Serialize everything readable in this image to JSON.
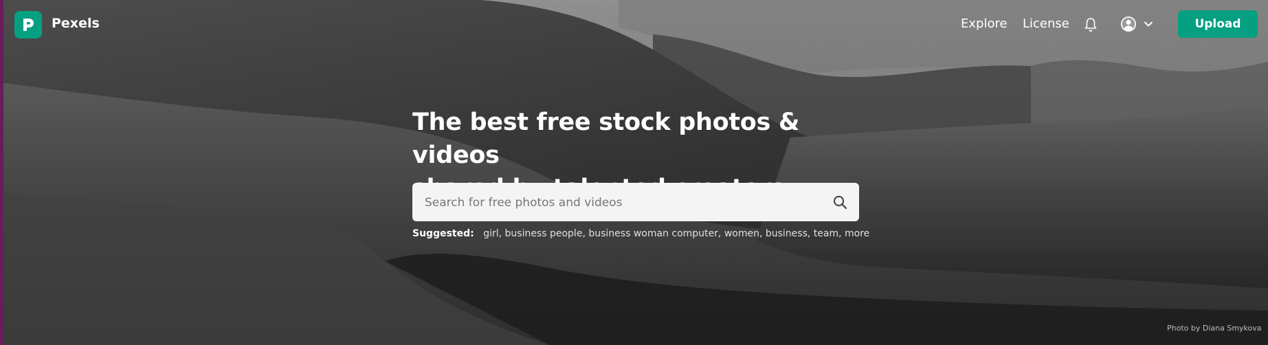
{
  "nav": {
    "brand": "Pexels",
    "brand_color": "#05a081",
    "links": [
      {
        "label": "Explore"
      },
      {
        "label": "License"
      }
    ],
    "upload_label": "Upload",
    "icons": [
      "bell-icon",
      "avatar-icon",
      "chevron-down-icon"
    ]
  },
  "hero": {
    "headline_line1": "The best free stock photos & videos",
    "headline_line2": "shared by talented creators.",
    "search_placeholder": "Search for free photos and videos",
    "suggested_label": "Suggested:",
    "suggestions": [
      "girl",
      "business people",
      "business woman computer",
      "women",
      "business",
      "team",
      "more"
    ],
    "photo_credit": "Photo by Diana Smykova"
  }
}
